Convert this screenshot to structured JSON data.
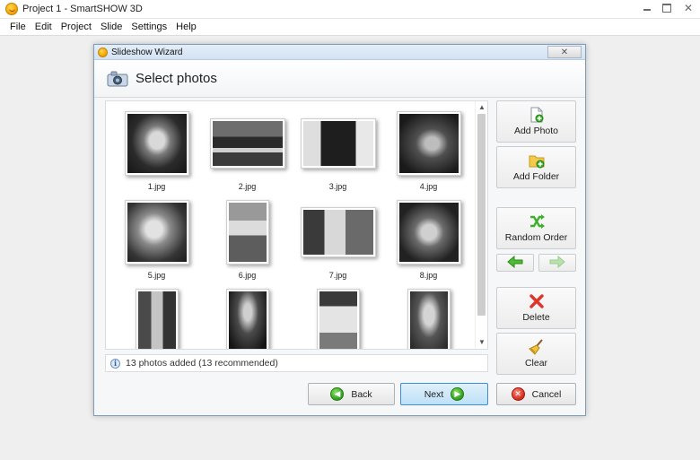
{
  "app": {
    "title": "Project 1 - SmartSHOW 3D",
    "menu": [
      "File",
      "Edit",
      "Project",
      "Slide",
      "Settings",
      "Help"
    ]
  },
  "dialog": {
    "title": "Slideshow Wizard",
    "close_label": "✕",
    "header": "Select photos",
    "photos": [
      {
        "label": "1.jpg",
        "shape": "sq",
        "tone": "bw1"
      },
      {
        "label": "2.jpg",
        "shape": "land",
        "tone": "bw2"
      },
      {
        "label": "3.jpg",
        "shape": "land",
        "tone": "bw3"
      },
      {
        "label": "4.jpg",
        "shape": "sq",
        "tone": "bw4"
      },
      {
        "label": "5.jpg",
        "shape": "sq",
        "tone": "bw5"
      },
      {
        "label": "6.jpg",
        "shape": "portrait",
        "tone": "bw6"
      },
      {
        "label": "7.jpg",
        "shape": "land",
        "tone": "bw7"
      },
      {
        "label": "8.jpg",
        "shape": "sq",
        "tone": "bw8"
      },
      {
        "label": "",
        "shape": "portrait",
        "tone": "bw9"
      },
      {
        "label": "",
        "shape": "portrait",
        "tone": "bw10"
      },
      {
        "label": "",
        "shape": "portrait",
        "tone": "bw11"
      },
      {
        "label": "",
        "shape": "portrait",
        "tone": "bw12"
      }
    ],
    "status": "13 photos added (13 recommended)",
    "side_buttons": {
      "add_photo": "Add Photo",
      "add_folder": "Add Folder",
      "random_order": "Random Order",
      "delete": "Delete",
      "clear": "Clear"
    },
    "bottom_buttons": {
      "back": "Back",
      "next": "Next",
      "cancel": "Cancel"
    }
  },
  "colors": {
    "accent_blue": "#3f8dd0",
    "arrow_green": "#3bb02a",
    "delete_red": "#e0342a"
  }
}
